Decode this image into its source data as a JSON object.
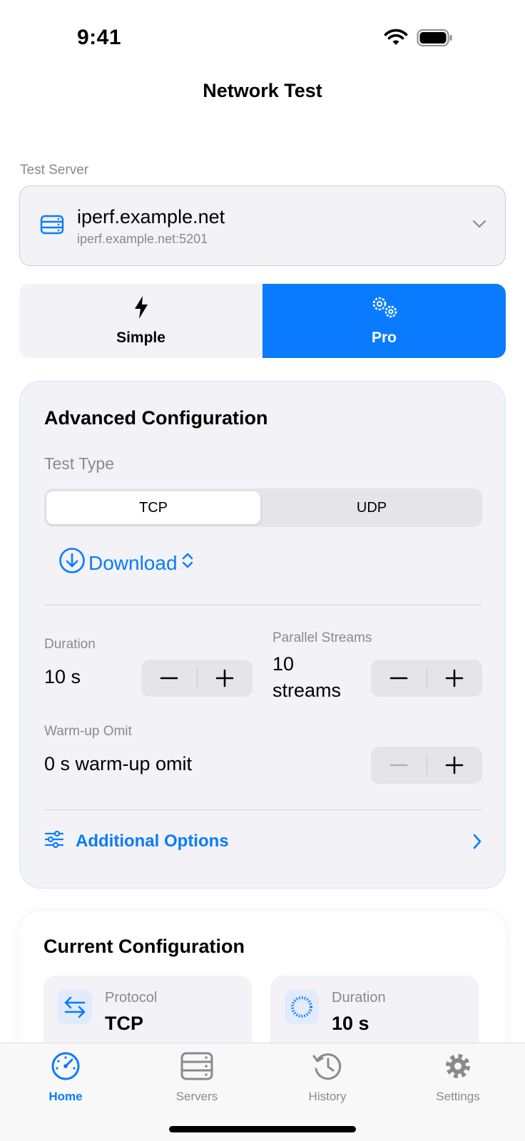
{
  "status_bar": {
    "time": "9:41",
    "icons": [
      "wifi-icon",
      "battery-icon"
    ]
  },
  "nav": {
    "title": "Network Test"
  },
  "server": {
    "section_label": "Test Server",
    "name": "iperf.example.net",
    "address": "iperf.example.net:5201",
    "icon": "server-icon"
  },
  "mode": {
    "options": [
      {
        "label": "Simple",
        "icon": "bolt-icon",
        "selected": false
      },
      {
        "label": "Pro",
        "icon": "gears-icon",
        "selected": true
      }
    ]
  },
  "advanced": {
    "title": "Advanced Configuration",
    "test_type_label": "Test Type",
    "protocols": [
      {
        "label": "TCP",
        "selected": true
      },
      {
        "label": "UDP",
        "selected": false
      }
    ],
    "direction": "Download",
    "duration": {
      "label": "Duration",
      "value": "10 s"
    },
    "parallel": {
      "label": "Parallel Streams",
      "value_line1": "10",
      "value_line2": "streams"
    },
    "warmup": {
      "label": "Warm-up Omit",
      "value": "0 s warm-up omit"
    },
    "additional_options": "Additional Options"
  },
  "current": {
    "title": "Current Configuration",
    "protocol": {
      "label": "Protocol",
      "value": "TCP"
    },
    "duration": {
      "label": "Duration",
      "value": "10 s"
    }
  },
  "tabs": [
    {
      "label": "Home",
      "icon": "speedometer-icon",
      "active": true
    },
    {
      "label": "Servers",
      "icon": "server-rack-icon",
      "active": false
    },
    {
      "label": "History",
      "icon": "history-icon",
      "active": false
    },
    {
      "label": "Settings",
      "icon": "gear-icon",
      "active": false
    }
  ],
  "colors": {
    "accent": "#0a7bff",
    "secondary_text": "#8a8a8e",
    "card_background": "#f2f2f7"
  }
}
